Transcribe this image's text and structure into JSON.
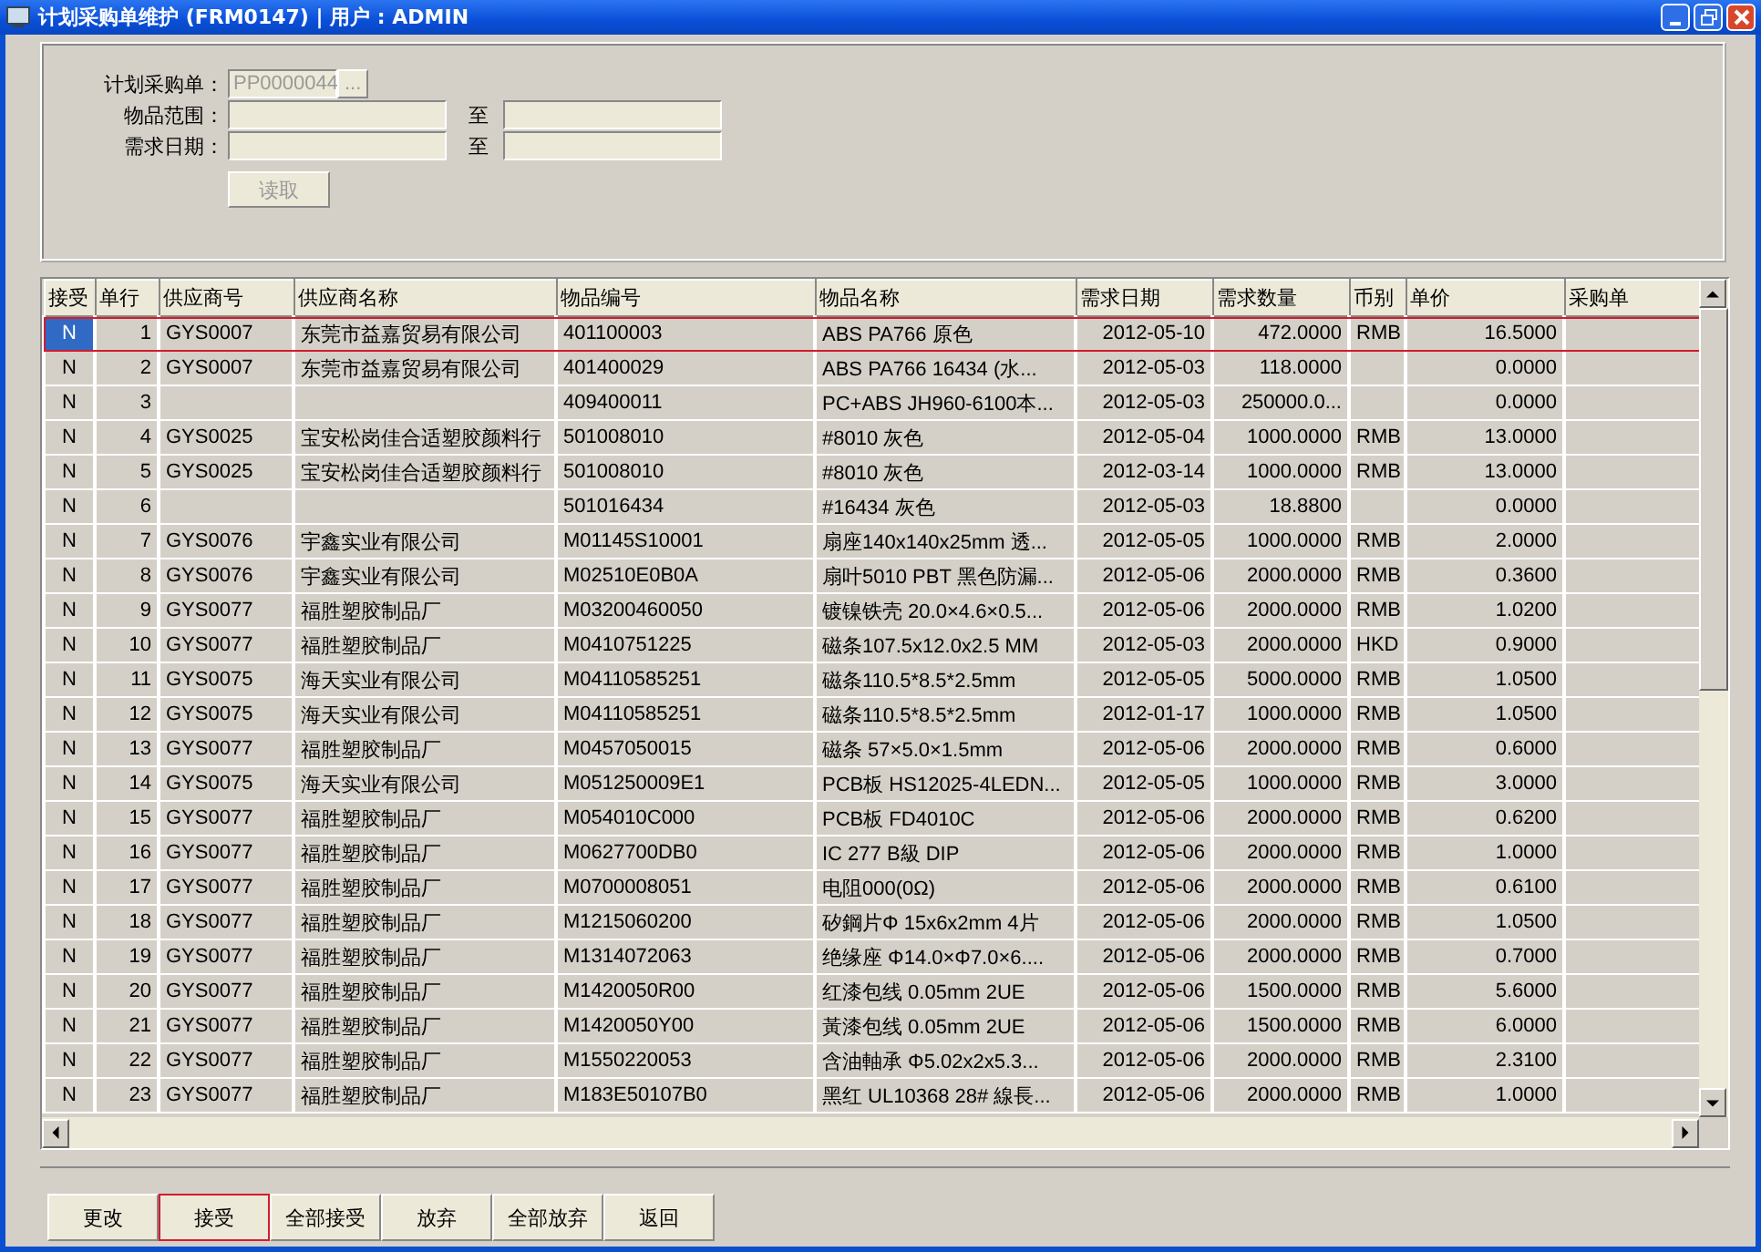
{
  "window": {
    "title": "计划采购单维护 (FRM0147) | 用户 : ADMIN"
  },
  "form": {
    "order": {
      "label": "计划采购单：",
      "value": "PP0000044",
      "browse": "...",
      "disabled": true
    },
    "item_range": {
      "label": "物品范围：",
      "to": "至"
    },
    "date_range": {
      "label": "需求日期：",
      "to": "至"
    },
    "read_button": {
      "label": "读取",
      "disabled": true
    }
  },
  "table": {
    "columns": [
      "接受",
      "单行",
      "供应商号",
      "供应商名称",
      "物品编号",
      "物品名称",
      "需求日期",
      "需求数量",
      "币别",
      "单价",
      "采购单"
    ],
    "rows": [
      {
        "selected": true,
        "cells": [
          "N",
          "1",
          "GYS0007",
          "东莞市益嘉贸易有限公司",
          "401100003",
          "ABS  PA766  原色",
          "2012-05-10",
          "472.0000",
          "RMB",
          "16.5000"
        ]
      },
      {
        "selected": false,
        "cells": [
          "N",
          "2",
          "GYS0007",
          "东莞市益嘉贸易有限公司",
          "401400029",
          "ABS  PA766  16434 (水...",
          "2012-05-03",
          "118.0000",
          "",
          "0.0000"
        ]
      },
      {
        "selected": false,
        "cells": [
          "N",
          "3",
          "",
          "",
          "409400011",
          "PC+ABS JH960-6100本...",
          "2012-05-03",
          "250000.0...",
          "",
          "0.0000"
        ]
      },
      {
        "selected": false,
        "cells": [
          "N",
          "4",
          "GYS0025",
          "宝安松岗佳合适塑胶颜料行",
          "501008010",
          "#8010   灰色",
          "2012-05-04",
          "1000.0000",
          "RMB",
          "13.0000"
        ]
      },
      {
        "selected": false,
        "cells": [
          "N",
          "5",
          "GYS0025",
          "宝安松岗佳合适塑胶颜料行",
          "501008010",
          "#8010   灰色",
          "2012-03-14",
          "1000.0000",
          "RMB",
          "13.0000"
        ]
      },
      {
        "selected": false,
        "cells": [
          "N",
          "6",
          "",
          "",
          "501016434",
          "#16434  灰色",
          "2012-05-03",
          "18.8800",
          "",
          "0.0000"
        ]
      },
      {
        "selected": false,
        "cells": [
          "N",
          "7",
          "GYS0076",
          "宇鑫实业有限公司",
          "M01145S10001",
          "扇座140x140x25mm 透...",
          "2012-05-05",
          "1000.0000",
          "RMB",
          "2.0000"
        ]
      },
      {
        "selected": false,
        "cells": [
          "N",
          "8",
          "GYS0076",
          "宇鑫实业有限公司",
          "M02510E0B0A",
          "扇叶5010 PBT 黑色防漏...",
          "2012-05-06",
          "2000.0000",
          "RMB",
          "0.3600"
        ]
      },
      {
        "selected": false,
        "cells": [
          "N",
          "9",
          "GYS0077",
          "福胜塑胶制品厂",
          "M03200460050",
          "镀镍铁壳 20.0×4.6×0.5...",
          "2012-05-06",
          "2000.0000",
          "RMB",
          "1.0200"
        ]
      },
      {
        "selected": false,
        "cells": [
          "N",
          "10",
          "GYS0077",
          "福胜塑胶制品厂",
          "M0410751225",
          "磁条107.5x12.0x2.5 MM",
          "2012-05-03",
          "2000.0000",
          "HKD",
          "0.9000"
        ]
      },
      {
        "selected": false,
        "cells": [
          "N",
          "11",
          "GYS0075",
          "海天实业有限公司",
          "M04110585251",
          "磁条110.5*8.5*2.5mm",
          "2012-05-05",
          "5000.0000",
          "RMB",
          "1.0500"
        ]
      },
      {
        "selected": false,
        "cells": [
          "N",
          "12",
          "GYS0075",
          "海天实业有限公司",
          "M04110585251",
          "磁条110.5*8.5*2.5mm",
          "2012-01-17",
          "1000.0000",
          "RMB",
          "1.0500"
        ]
      },
      {
        "selected": false,
        "cells": [
          "N",
          "13",
          "GYS0077",
          "福胜塑胶制品厂",
          "M0457050015",
          "磁条 57×5.0×1.5mm",
          "2012-05-06",
          "2000.0000",
          "RMB",
          "0.6000"
        ]
      },
      {
        "selected": false,
        "cells": [
          "N",
          "14",
          "GYS0075",
          "海天实业有限公司",
          "M051250009E1",
          "PCB板  HS12025-4LEDN...",
          "2012-05-05",
          "1000.0000",
          "RMB",
          "3.0000"
        ]
      },
      {
        "selected": false,
        "cells": [
          "N",
          "15",
          "GYS0077",
          "福胜塑胶制品厂",
          "M054010C000",
          "PCB板 FD4010C",
          "2012-05-06",
          "2000.0000",
          "RMB",
          "0.6200"
        ]
      },
      {
        "selected": false,
        "cells": [
          "N",
          "16",
          "GYS0077",
          "福胜塑胶制品厂",
          "M0627700DB0",
          "IC  277  B級   DIP",
          "2012-05-06",
          "2000.0000",
          "RMB",
          "1.0000"
        ]
      },
      {
        "selected": false,
        "cells": [
          "N",
          "17",
          "GYS0077",
          "福胜塑胶制品厂",
          "M0700008051",
          "电阻000(0Ω)",
          "2012-05-06",
          "2000.0000",
          "RMB",
          "0.6100"
        ]
      },
      {
        "selected": false,
        "cells": [
          "N",
          "18",
          "GYS0077",
          "福胜塑胶制品厂",
          "M1215060200",
          "矽鋼片Φ 15x6x2mm  4片",
          "2012-05-06",
          "2000.0000",
          "RMB",
          "1.0500"
        ]
      },
      {
        "selected": false,
        "cells": [
          "N",
          "19",
          "GYS0077",
          "福胜塑胶制品厂",
          "M1314072063",
          "绝缘座 Φ14.0×Φ7.0×6....",
          "2012-05-06",
          "2000.0000",
          "RMB",
          "0.7000"
        ]
      },
      {
        "selected": false,
        "cells": [
          "N",
          "20",
          "GYS0077",
          "福胜塑胶制品厂",
          "M1420050R00",
          "红漆包线 0.05mm  2UE",
          "2012-05-06",
          "1500.0000",
          "RMB",
          "5.6000"
        ]
      },
      {
        "selected": false,
        "cells": [
          "N",
          "21",
          "GYS0077",
          "福胜塑胶制品厂",
          "M1420050Y00",
          "黃漆包线 0.05mm  2UE",
          "2012-05-06",
          "1500.0000",
          "RMB",
          "6.0000"
        ]
      },
      {
        "selected": false,
        "cells": [
          "N",
          "22",
          "GYS0077",
          "福胜塑胶制品厂",
          "M1550220053",
          "含油軸承  Φ5.02x2x5.3...",
          "2012-05-06",
          "2000.0000",
          "RMB",
          "2.3100"
        ]
      },
      {
        "selected": false,
        "cells": [
          "N",
          "23",
          "GYS0077",
          "福胜塑胶制品厂",
          "M183E50107B0",
          "黑红 UL10368 28# 線長...",
          "2012-05-06",
          "2000.0000",
          "RMB",
          "1.0000"
        ]
      }
    ]
  },
  "buttons": [
    {
      "label": "更改",
      "focused": false
    },
    {
      "label": "接受",
      "focused": true
    },
    {
      "label": "全部接受",
      "focused": false
    },
    {
      "label": "放弃",
      "focused": false
    },
    {
      "label": "全部放弃",
      "focused": false
    },
    {
      "label": "返回",
      "focused": false
    }
  ]
}
